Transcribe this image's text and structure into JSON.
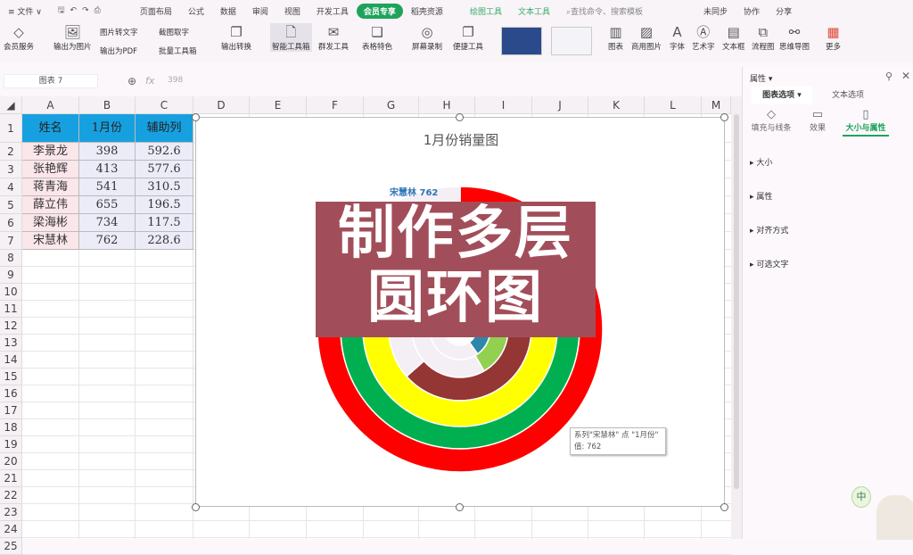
{
  "menubar": {
    "items": [
      "≡ 文件 ∨",
      "页面布局",
      "公式",
      "数据",
      "审阅",
      "视图",
      "开发工具",
      "会员专享",
      "稻壳资源",
      "绘图工具",
      "文本工具"
    ],
    "search": "查找命令、搜索模板",
    "right": [
      "未同步",
      "协作",
      "分享"
    ]
  },
  "ribbon": {
    "big": [
      "会员服务",
      "输出为图片",
      "输出转换",
      "智能工具箱",
      "群发工具",
      "表格特色",
      "屏幕录制",
      "便捷工具",
      "图表",
      "商用图片",
      "字体",
      "艺术字",
      "文本框",
      "流程图",
      "思维导图",
      "更多"
    ],
    "small": [
      "图片转文字",
      "截图取字",
      "输出为PDF",
      "批量工具箱"
    ]
  },
  "formula_bar": {
    "name_box": "图表 7",
    "fx": "fx",
    "value": "398"
  },
  "columns": [
    "A",
    "B",
    "C",
    "D",
    "E",
    "F",
    "G",
    "H",
    "I",
    "J",
    "K",
    "L",
    "M"
  ],
  "table": {
    "headers": [
      "姓名",
      "1月份",
      "辅助列"
    ],
    "rows": [
      [
        "李景龙",
        "398",
        "592.6"
      ],
      [
        "张艳辉",
        "413",
        "577.6"
      ],
      [
        "蒋青海",
        "541",
        "310.5"
      ],
      [
        "薛立伟",
        "655",
        "196.5"
      ],
      [
        "梁海彬",
        "734",
        "117.5"
      ],
      [
        "宋慧林",
        "762",
        "228.6"
      ]
    ]
  },
  "chart_data": {
    "type": "doughnut",
    "title": "1月份销量图",
    "categories": [
      "1月份",
      "辅助列"
    ],
    "series": [
      {
        "name": "李景龙",
        "values": [
          398,
          592.6
        ],
        "color": "#2e86ab"
      },
      {
        "name": "张艳辉",
        "values": [
          413,
          577.6
        ],
        "color": "#92d050"
      },
      {
        "name": "蒋青海",
        "values": [
          541,
          310.5
        ],
        "color": "#943634"
      },
      {
        "name": "薛立伟",
        "values": [
          655,
          196.5
        ],
        "color": "#ffff00"
      },
      {
        "name": "梁海彬",
        "values": [
          734,
          117.5
        ],
        "color": "#00b050"
      },
      {
        "name": "宋慧林",
        "values": [
          762,
          228.6
        ],
        "color": "#ff0000"
      }
    ],
    "helper_color": "#f4eff4",
    "data_label": "宋慧林 762"
  },
  "overlay": {
    "line1": "制作多层",
    "line2": "圆环图"
  },
  "tooltip": {
    "line1": "系列\"宋慧林\" 点 \"1月份\"",
    "line2": "值: 762"
  },
  "panel": {
    "title": "属性 ▾",
    "tabs": [
      "图表选项 ▾",
      "文本选项"
    ],
    "subtabs": [
      "填充与线条",
      "效果",
      "大小与属性"
    ],
    "sections": [
      "大小",
      "属性",
      "对齐方式",
      "可选文字"
    ]
  }
}
